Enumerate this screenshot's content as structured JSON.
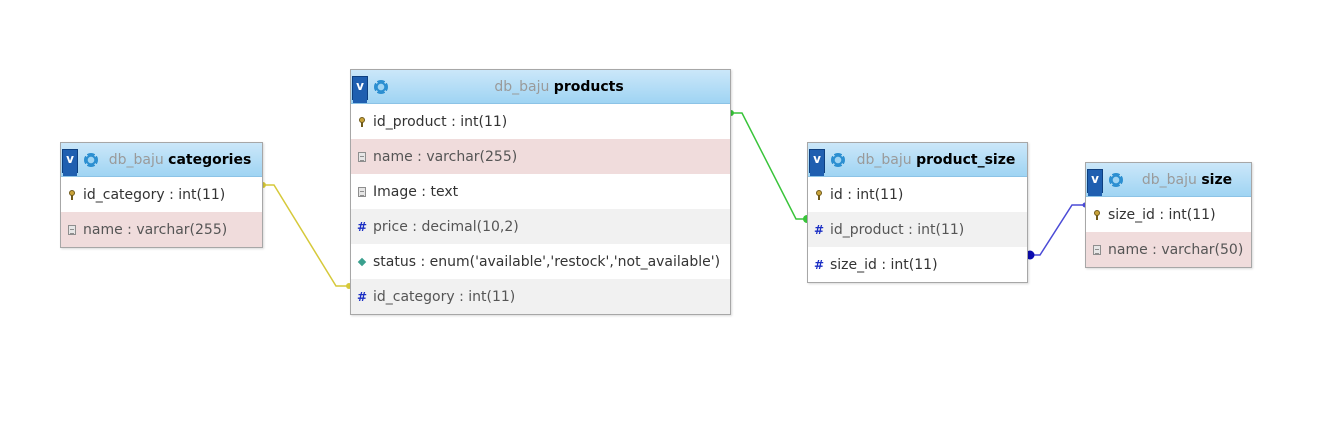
{
  "tables": {
    "categories": {
      "db": "db_baju",
      "name": "categories",
      "toggle": "v",
      "columns": [
        {
          "label": "id_category : int(11)",
          "icon": "key-icon"
        },
        {
          "label": "name : varchar(255)",
          "icon": "text-icon"
        }
      ]
    },
    "products": {
      "db": "db_baju",
      "name": "products",
      "toggle": "v",
      "columns": [
        {
          "label": "id_product : int(11)",
          "icon": "key-icon"
        },
        {
          "label": "name : varchar(255)",
          "icon": "text-icon"
        },
        {
          "label": "Image : text",
          "icon": "text-icon"
        },
        {
          "label": "price : decimal(10,2)",
          "icon": "number-icon"
        },
        {
          "label": "status : enum('available','restock','not_available')",
          "icon": "enum-icon"
        },
        {
          "label": "id_category : int(11)",
          "icon": "number-icon"
        }
      ]
    },
    "product_size": {
      "db": "db_baju",
      "name": "product_size",
      "toggle": "v",
      "columns": [
        {
          "label": "id : int(11)",
          "icon": "key-icon"
        },
        {
          "label": "id_product : int(11)",
          "icon": "number-icon"
        },
        {
          "label": "size_id : int(11)",
          "icon": "number-icon"
        }
      ]
    },
    "size": {
      "db": "db_baju",
      "name": "size",
      "toggle": "v",
      "columns": [
        {
          "label": "size_id : int(11)",
          "icon": "key-icon"
        },
        {
          "label": "name : varchar(50)",
          "icon": "text-icon"
        }
      ]
    }
  },
  "relations": [
    {
      "from": "categories.id_category",
      "to": "products.id_category",
      "color": "#d6c93a"
    },
    {
      "from": "products.id_product",
      "to": "product_size.id_product",
      "color": "#39c43a"
    },
    {
      "from": "size.size_id",
      "to": "product_size.size_id",
      "color": "#4b4bd6"
    }
  ]
}
